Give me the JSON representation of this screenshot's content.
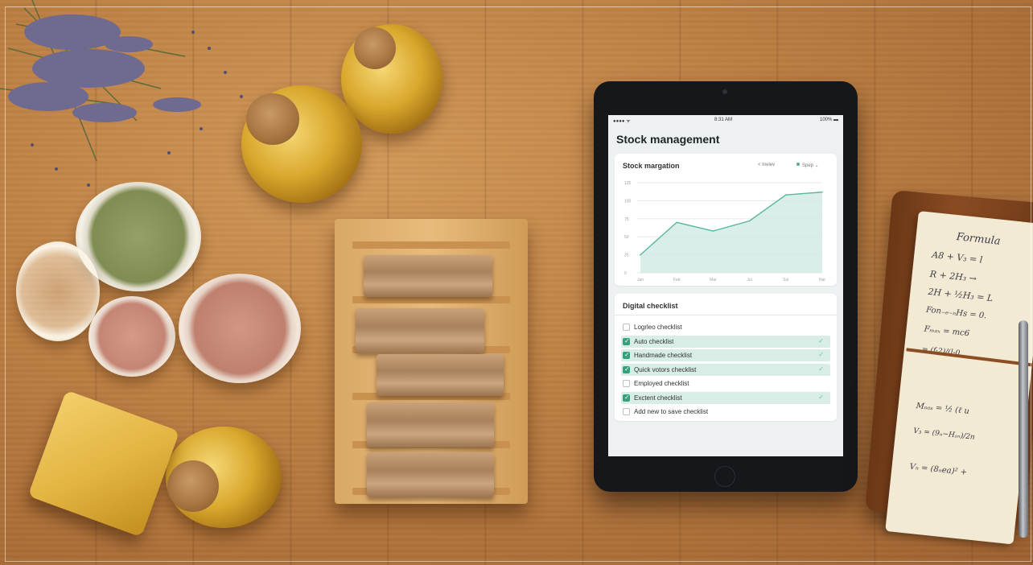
{
  "tablet": {
    "status": {
      "left": "●●●● ᯤ",
      "time": "8:31 AM",
      "battery": "100% ▬"
    },
    "title": "Stock management",
    "chart_card": {
      "title": "Stock margation",
      "control_left": "< Inelev",
      "control_right": "Spep ⌄"
    },
    "checklist": {
      "title": "Digital checklist",
      "items": [
        {
          "label": "Logrleo checklist",
          "checked": false
        },
        {
          "label": "Auto checklist",
          "checked": true
        },
        {
          "label": "Handmade checklist",
          "checked": true
        },
        {
          "label": "Quick votors checklist",
          "checked": true
        },
        {
          "label": "Employed checklist",
          "checked": false
        },
        {
          "label": "Exctent checklist",
          "checked": true
        },
        {
          "label": "Add new to save checklist",
          "checked": false
        }
      ],
      "check_mark": "✓"
    }
  },
  "chart_data": {
    "type": "area",
    "categories": [
      "Jan",
      "Feb",
      "Mar",
      "Jul",
      "Sul",
      "Nar"
    ],
    "x": [
      0,
      1,
      2,
      3,
      4,
      5,
      6
    ],
    "values": [
      25,
      70,
      58,
      72,
      108,
      112
    ],
    "yticks": [
      "0",
      "25",
      "50",
      "75",
      "100",
      "125"
    ],
    "ylim": [
      0,
      125
    ],
    "grid": true,
    "line_color": "#55b79c",
    "fill_color": "#cfeae2"
  },
  "notebook": {
    "lines": [
      "Formula",
      "A8 + V₃ = l",
      "R + 2H₃ →",
      "2H + ½H₃ = L",
      "Fon₋ₑ₋ₙHs = 0.",
      "Fₘₐₓ = mc6",
      "= (f-2)/(l-0",
      "Mₒₐₛ = ½ (ℓ u",
      "V₃ = (9ₙ−Hₐₙ)/2n",
      "Vₙ = (8ₙea)² +"
    ]
  }
}
